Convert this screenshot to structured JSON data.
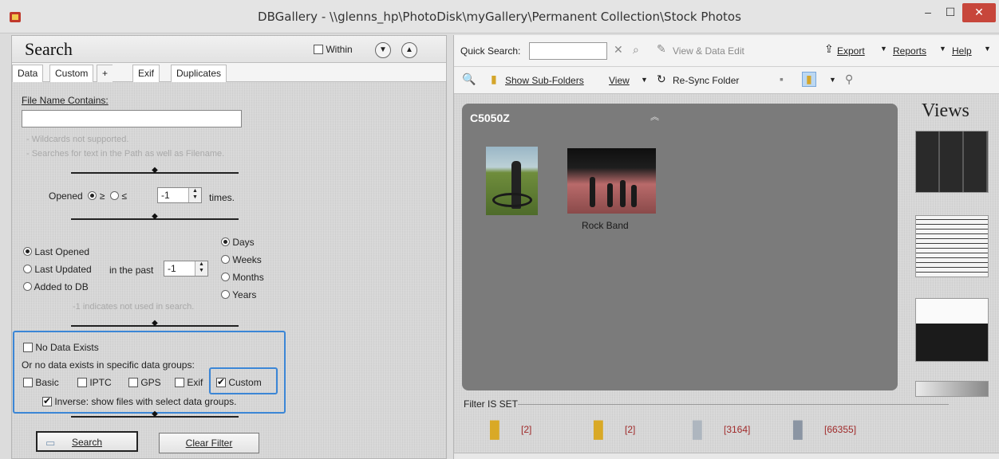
{
  "window": {
    "title": "DBGallery - \\\\glenns_hp\\PhotoDisk\\myGallery\\Permanent Collection\\Stock Photos",
    "minimize": "–",
    "maximize": "☐",
    "close": "✕"
  },
  "search": {
    "title": "Search",
    "within_label": "Within",
    "tabs": [
      "Data",
      "Custom",
      "+",
      "Exif",
      "Duplicates"
    ],
    "file_name_label": "File Name Contains:",
    "file_name_value": "",
    "hint_wildcards": "- Wildcards not supported.",
    "hint_searches": "- Searches for text in the Path as well as Filename.",
    "opened_label": "Opened",
    "opened_gte": "≥",
    "opened_lte": "≤",
    "opened_value": "-1",
    "times_label": "times.",
    "date_modes": [
      "Last Opened",
      "Last Updated",
      "Added to DB"
    ],
    "in_the_past": "in the past",
    "past_value": "-1",
    "periods": [
      "Days",
      "Weeks",
      "Months",
      "Years"
    ],
    "hint_unused": "-1 indicates not used in search.",
    "no_data_exists": "No Data Exists",
    "no_data_specific": "Or no data exists in specific data groups:",
    "groups": [
      "Basic",
      "IPTC",
      "GPS",
      "Exif",
      "Custom"
    ],
    "inverse_label": "Inverse: show files with select data groups.",
    "search_button": "Search",
    "clear_button": "Clear Filter"
  },
  "toolbar": {
    "quick_search_label": "Quick Search:",
    "quick_search_value": "",
    "view_data_edit": "View & Data Edit",
    "export": "Export",
    "reports": "Reports",
    "help": "Help",
    "show_subfolders": "Show Sub-Folders",
    "view": "View",
    "resync": "Re-Sync Folder"
  },
  "gallery": {
    "folder_title": "C5050Z",
    "photo_caption": "Rock Band"
  },
  "views": {
    "title": "Views"
  },
  "filter": {
    "label": "Filter IS SET",
    "counts": [
      "[2]",
      "[2]",
      "[3164]",
      "[66355]"
    ]
  }
}
